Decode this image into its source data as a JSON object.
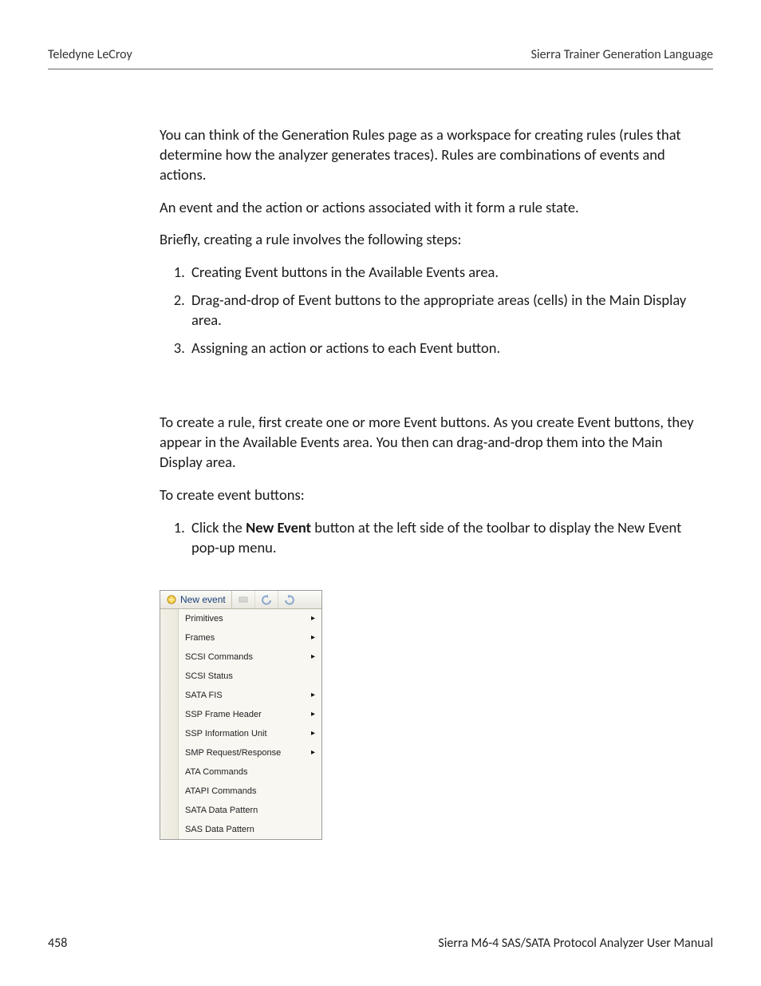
{
  "header": {
    "left": "Teledyne LeCroy",
    "right": "Sierra Trainer Generation Language"
  },
  "body": {
    "p1": "You can think of the Generation Rules page as a workspace for creating rules (rules that determine how the analyzer generates traces). Rules are combinations of events and actions.",
    "p2": "An event and the action or actions associated with it form a rule state.",
    "p3": "Briefly, creating a rule involves the following steps:",
    "steps1": [
      "Creating Event buttons in the Available Events area.",
      "Drag-and-drop of Event buttons to the appropriate areas (cells) in the Main Display area.",
      "Assigning an action or actions to each Event button."
    ],
    "p4": "To create a rule, first create one or more Event buttons. As you create Event buttons, they appear in the Available Events area. You then can drag-and-drop them into the Main Display area.",
    "p5": "To create event buttons:",
    "step2_pre": "Click the ",
    "step2_bold": "New Event",
    "step2_post": " button at the left side of the toolbar to display the New Event pop-up menu."
  },
  "popup": {
    "toolbar": {
      "new_event_label": "New event"
    },
    "items": [
      {
        "label": "Primitives",
        "submenu": true
      },
      {
        "label": "Frames",
        "submenu": true
      },
      {
        "label": "SCSI Commands",
        "submenu": true
      },
      {
        "label": "SCSI Status",
        "submenu": false
      },
      {
        "label": "SATA FIS",
        "submenu": true
      },
      {
        "label": "SSP Frame Header",
        "submenu": true
      },
      {
        "label": "SSP Information Unit",
        "submenu": true
      },
      {
        "label": "SMP Request/Response",
        "submenu": true
      },
      {
        "label": "ATA Commands",
        "submenu": false
      },
      {
        "label": "ATAPI Commands",
        "submenu": false
      },
      {
        "label": "SATA Data Pattern",
        "submenu": false
      },
      {
        "label": "SAS Data Pattern",
        "submenu": false
      }
    ]
  },
  "footer": {
    "page_number": "458",
    "manual_title": "Sierra M6-4 SAS/SATA Protocol Analyzer User Manual"
  }
}
